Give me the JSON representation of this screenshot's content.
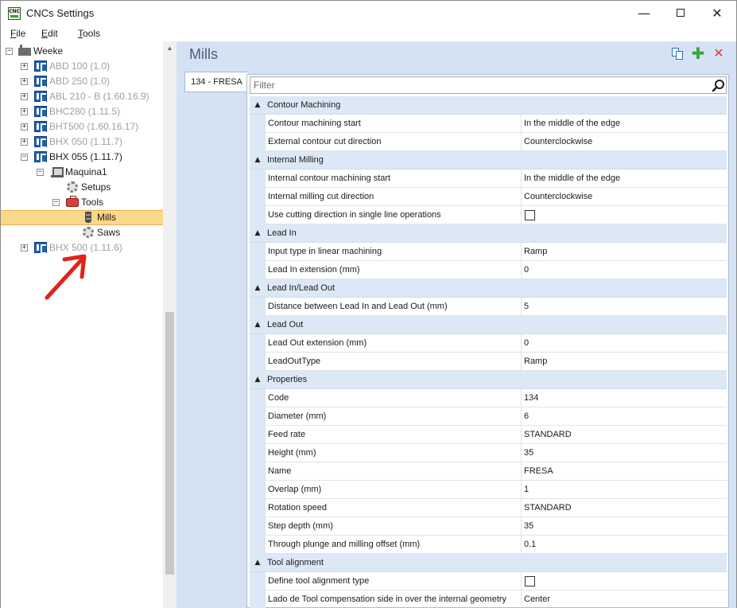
{
  "window": {
    "title": "CNCs Settings",
    "icon_label": "CNC",
    "minimize_glyph": "—",
    "close_glyph": "✕"
  },
  "menu": {
    "file": {
      "underline": "F",
      "rest": "ile"
    },
    "edit": {
      "underline": "E",
      "rest": "dit"
    },
    "tools": {
      "underline": "T",
      "rest": "ools"
    }
  },
  "tree": {
    "root": {
      "label": "Weeke",
      "expander": "−"
    },
    "machines": [
      {
        "label": "ABD 100 (1.0)",
        "expander": "+"
      },
      {
        "label": "ABD 250 (1.0)",
        "expander": "+"
      },
      {
        "label": "ABL 210 - B (1.60.16.9)",
        "expander": "+"
      },
      {
        "label": "BHC280 (1.11.5)",
        "expander": "+"
      },
      {
        "label": "BHT500 (1.60.16.17)",
        "expander": "+"
      },
      {
        "label": "BHX 050 (1.11.7)",
        "expander": "+"
      },
      {
        "label": "BHX 055 (1.11.7)",
        "expander": "−"
      }
    ],
    "maquina": {
      "label": "Maquina1",
      "expander": "−"
    },
    "setups": {
      "label": "Setups"
    },
    "tools": {
      "label": "Tools",
      "expander": "−"
    },
    "mills": {
      "label": "Mills"
    },
    "saws": {
      "label": "Saws"
    },
    "last_machine": {
      "label": "BHX 500 (1.11.6)",
      "expander": "+"
    }
  },
  "panel": {
    "title": "Mills",
    "tab_label": "134 - FRESA",
    "filter_placeholder": "Filter",
    "actions": {
      "copy": "copy-icon",
      "add": "add-icon",
      "delete": "delete-icon",
      "add_glyph": "✚",
      "delete_glyph": "✕"
    }
  },
  "properties": {
    "contour": {
      "title": "Contour Machining",
      "rows": [
        {
          "name": "Contour machining start",
          "value": "In the middle of the edge"
        },
        {
          "name": "External contour cut direction",
          "value": "Counterclockwise"
        }
      ]
    },
    "internal": {
      "title": "Internal Milling",
      "rows": [
        {
          "name": "Internal contour machining start",
          "value": "In the middle of the edge"
        },
        {
          "name": "Internal milling cut direction",
          "value": "Counterclockwise"
        },
        {
          "name": "Use cutting direction in single line operations",
          "value": ""
        }
      ]
    },
    "leadin": {
      "title": "Lead In",
      "rows": [
        {
          "name": "Input type in linear machining",
          "value": "Ramp"
        },
        {
          "name": "Lead In extension (mm)",
          "value": "0"
        }
      ]
    },
    "leadinout": {
      "title": "Lead In/Lead Out",
      "rows": [
        {
          "name": "Distance between Lead In and Lead Out (mm)",
          "value": "5"
        }
      ]
    },
    "leadout": {
      "title": "Lead Out",
      "rows": [
        {
          "name": "Lead Out extension (mm)",
          "value": "0"
        },
        {
          "name": "LeadOutType",
          "value": "Ramp"
        }
      ]
    },
    "props": {
      "title": "Properties",
      "rows": [
        {
          "name": "Code",
          "value": "134"
        },
        {
          "name": "Diameter (mm)",
          "value": "6"
        },
        {
          "name": "Feed rate",
          "value": "STANDARD"
        },
        {
          "name": "Height (mm)",
          "value": "35"
        },
        {
          "name": "Name",
          "value": "FRESA"
        },
        {
          "name": "Overlap (mm)",
          "value": "1"
        },
        {
          "name": "Rotation speed",
          "value": "STANDARD"
        },
        {
          "name": "Step depth (mm)",
          "value": "35"
        },
        {
          "name": "Through plunge and milling offset (mm)",
          "value": "0.1"
        }
      ]
    },
    "align": {
      "title": "Tool alignment",
      "rows": [
        {
          "name": "Define tool alignment type",
          "value": ""
        },
        {
          "name": "Lado de Tool compensation side in over the internal geometry",
          "value": "Center"
        }
      ]
    },
    "collapse_glyph": "▲"
  },
  "colors": {
    "selection": "#fbd88a",
    "panel_bg": "#d4e2f4",
    "category_bg": "#dce8f5",
    "annotation_arrow": "#e0241b"
  }
}
